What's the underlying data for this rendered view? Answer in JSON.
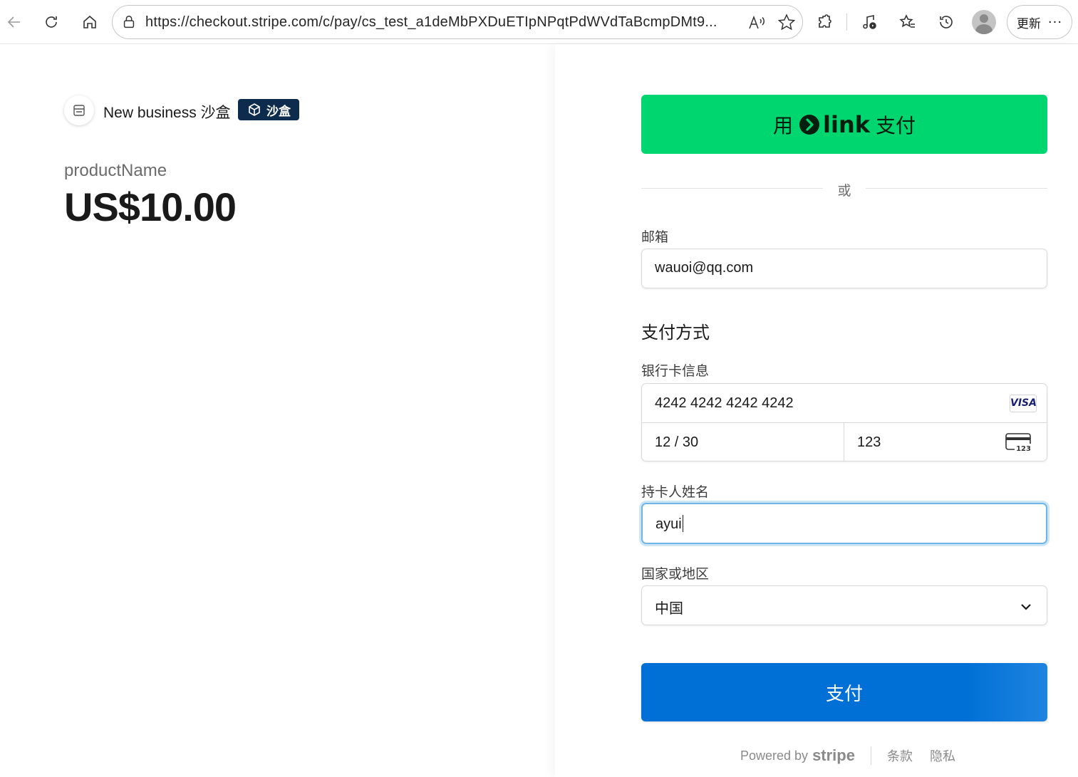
{
  "browser": {
    "url": "https://checkout.stripe.com/c/pay/cs_test_a1deMbPXDuETIpNPqtPdWVdTaBcmpDMt9...",
    "update_label": "更新",
    "more_label": "···"
  },
  "merchant": {
    "name": "New business 沙盒",
    "sandbox_badge": "沙盒"
  },
  "product": {
    "name": "productName",
    "price": "US$10.00"
  },
  "checkout": {
    "link_prefix": "用",
    "link_brand": "link",
    "link_suffix": "支付",
    "divider_text": "或",
    "email_label": "邮箱",
    "email_value": "wauoi@qq.com",
    "payment_method_title": "支付方式",
    "card_info_label": "银行卡信息",
    "card_number": "4242 4242 4242 4242",
    "card_brand": "VISA",
    "card_expiry": "12 / 30",
    "card_cvc": "123",
    "cardholder_label": "持卡人姓名",
    "cardholder_value": "ayui",
    "country_label": "国家或地区",
    "country_value": "中国",
    "pay_label": "支付"
  },
  "footer": {
    "powered_by": "Powered by",
    "stripe": "stripe",
    "terms": "条款",
    "privacy": "隐私"
  },
  "colors": {
    "link_green": "#00d66f",
    "pay_blue": "#0070d6",
    "sandbox_navy": "#0c2b4d",
    "focus_ring": "#6fb6e6"
  }
}
